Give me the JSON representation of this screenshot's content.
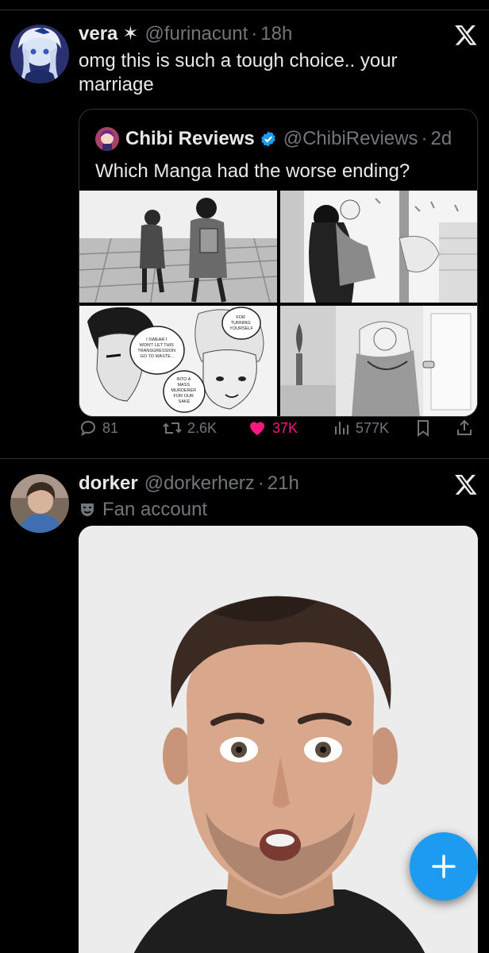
{
  "tweets": [
    {
      "display_name": "vera",
      "name_symbol": "✶",
      "handle": "@furinacunt",
      "separator": "·",
      "time": "18h",
      "text": "omg this is such a tough choice.. your marriage",
      "avatar_icon": "anime-character-avatar",
      "quote": {
        "display_name": "Chibi Reviews",
        "verified_icon": "verified-badge-icon",
        "handle": "@ChibiReviews",
        "separator": "·",
        "time": "2d",
        "text": "Which Manga had the worse ending?",
        "images": [
          "manga-panel-walking-away",
          "manga-panel-embrace",
          "manga-panel-two-characters",
          "manga-panel-hug-by-window"
        ],
        "panel_text": {
          "left_bubble": "I SWEAR I WON'T LET THIS TRANSGRESSION GO TO WASTE...",
          "right_bubble_top": "FOR TURNING YOURSELF",
          "right_bubble_bottom": "INTO A MASS MURDERER FOR OUR SAKE"
        }
      },
      "actions": {
        "replies": "81",
        "reposts": "2.6K",
        "likes": "37K",
        "views": "577K"
      }
    },
    {
      "display_name": "dorker",
      "handle": "@dorkerherz",
      "separator": "·",
      "time": "21h",
      "label": "Fan account",
      "label_icon": "theater-mask-icon",
      "avatar_icon": "person-photo-avatar",
      "media": "photo-surprised-man"
    }
  ],
  "colors": {
    "background": "#000000",
    "text_primary": "#e7e9ea",
    "text_secondary": "#71767b",
    "like_active": "#f91880",
    "accent": "#1d9bf0",
    "border": "#2f3336"
  },
  "fab": {
    "icon": "plus-icon"
  }
}
